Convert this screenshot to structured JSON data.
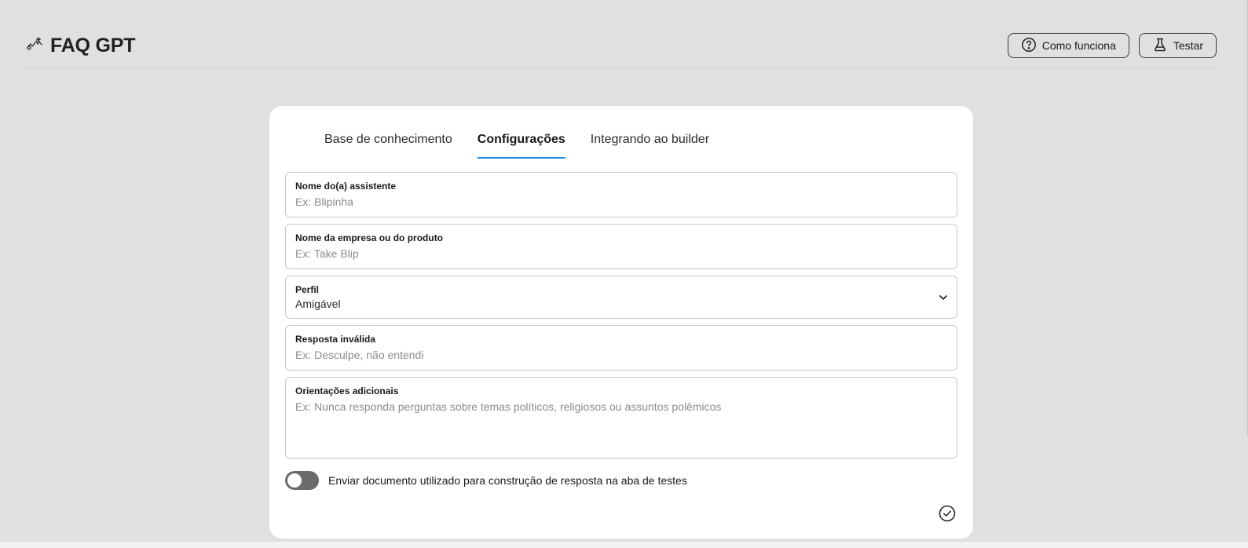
{
  "header": {
    "title": "FAQ GPT",
    "logo_icon": "gpt-sparkle-icon",
    "buttons": [
      {
        "label": "Como funciona",
        "icon": "question-circle-icon"
      },
      {
        "label": "Testar",
        "icon": "flask-icon"
      }
    ]
  },
  "tabs": [
    {
      "label": "Base de conhecimento",
      "active": false
    },
    {
      "label": "Configurações",
      "active": true
    },
    {
      "label": "Integrando ao builder",
      "active": false
    }
  ],
  "form": {
    "assistant_name": {
      "label": "Nome do(a) assistente",
      "value": "",
      "placeholder": "Ex: Blipinha"
    },
    "company_name": {
      "label": "Nome da empresa ou do produto",
      "value": "",
      "placeholder": "Ex: Take Blip"
    },
    "profile": {
      "label": "Perfil",
      "value": "Amigável"
    },
    "invalid_response": {
      "label": "Resposta inválida",
      "value": "",
      "placeholder": "Ex: Desculpe, não entendi"
    },
    "additional_guidance": {
      "label": "Orientações adicionais",
      "value": "",
      "placeholder": "Ex: Nunca responda perguntas sobre temas políticos, religiosos ou assuntos polêmicos"
    },
    "send_document_toggle": {
      "label": "Enviar documento utilizado para construção de resposta na aba de testes",
      "on": false
    }
  },
  "colors": {
    "background": "#e0e0e0",
    "card": "#ffffff",
    "accent": "#1e88e5",
    "toggle_off": "#6b6b6b"
  }
}
